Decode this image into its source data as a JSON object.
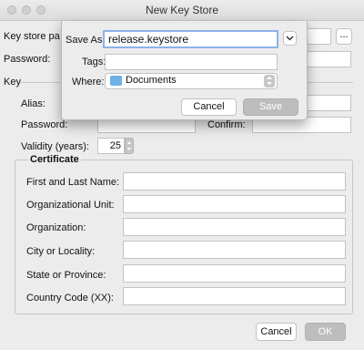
{
  "window": {
    "title": "New Key Store"
  },
  "main": {
    "keystore_path_label": "Key store pa",
    "password_label": "Password:",
    "browse_label": "...",
    "key_section_label": "Key",
    "alias_label": "Alias:",
    "key_password_label": "Password:",
    "confirm_label": "Confirm:",
    "validity_label": "Validity (years):",
    "validity_value": "25",
    "certificate": {
      "title": "Certificate",
      "fields": [
        {
          "label": "First and Last Name:",
          "value": ""
        },
        {
          "label": "Organizational Unit:",
          "value": ""
        },
        {
          "label": "Organization:",
          "value": ""
        },
        {
          "label": "City or Locality:",
          "value": ""
        },
        {
          "label": "State or Province:",
          "value": ""
        },
        {
          "label": "Country Code (XX):",
          "value": ""
        }
      ]
    },
    "cancel_label": "Cancel",
    "ok_label": "OK"
  },
  "save_sheet": {
    "save_as_label": "Save As:",
    "save_as_value": "release.keystore",
    "tags_label": "Tags:",
    "tags_value": "",
    "where_label": "Where:",
    "where_value": "Documents",
    "where_icon": "folder-icon",
    "cancel_label": "Cancel",
    "save_label": "Save"
  }
}
